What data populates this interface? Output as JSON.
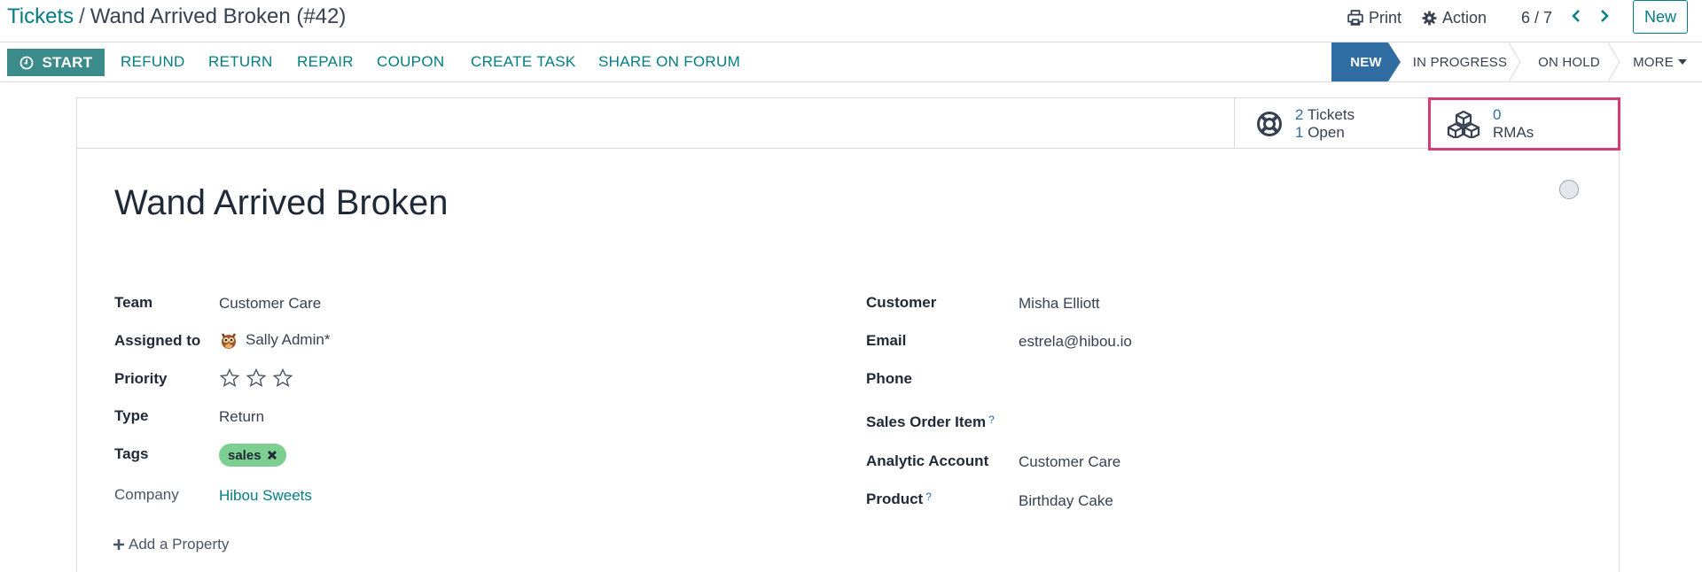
{
  "breadcrumb": {
    "root": "Tickets",
    "separator": "/",
    "current": "Wand Arrived Broken (#42)"
  },
  "toolbar": {
    "print_label": "Print",
    "action_label": "Action",
    "pager": "6 / 7",
    "new_label": "New"
  },
  "actions": {
    "start_label": "START",
    "links": [
      "REFUND",
      "RETURN",
      "REPAIR",
      "COUPON",
      "CREATE TASK",
      "SHARE ON FORUM"
    ]
  },
  "status": {
    "stages": [
      "NEW",
      "IN PROGRESS",
      "ON HOLD"
    ],
    "more_label": "MORE",
    "active": "NEW",
    "active_color": "#2f6da3"
  },
  "smart_buttons": {
    "tickets": {
      "count": "2",
      "label": "Tickets",
      "open_count": "1",
      "open_label": "Open"
    },
    "rmas": {
      "count": "0",
      "label": "RMAs",
      "highlight_color": "#d63c73"
    }
  },
  "ticket": {
    "title": "Wand Arrived Broken"
  },
  "left_fields": {
    "team": {
      "label": "Team",
      "value": "Customer Care"
    },
    "assigned": {
      "label": "Assigned to",
      "value": "Sally Admin*"
    },
    "priority": {
      "label": "Priority",
      "stars": 0,
      "max_stars": 3
    },
    "type": {
      "label": "Type",
      "value": "Return"
    },
    "tags": {
      "label": "Tags",
      "items": [
        "sales"
      ]
    },
    "company": {
      "label": "Company",
      "value": "Hibou Sweets"
    }
  },
  "right_fields": {
    "customer": {
      "label": "Customer",
      "value": "Misha Elliott"
    },
    "email": {
      "label": "Email",
      "value": "estrela@hibou.io"
    },
    "phone": {
      "label": "Phone",
      "value": ""
    },
    "sales_order_item": {
      "label": "Sales Order Item",
      "help": "?"
    },
    "analytic_account": {
      "label": "Analytic Account",
      "value": "Customer Care"
    },
    "product": {
      "label": "Product",
      "help": "?",
      "value": "Birthday Cake"
    }
  },
  "add_property_label": "Add a Property",
  "colors": {
    "brand": "#017e84",
    "start_button": "#3a8b8a",
    "tag": "#7dce91"
  }
}
